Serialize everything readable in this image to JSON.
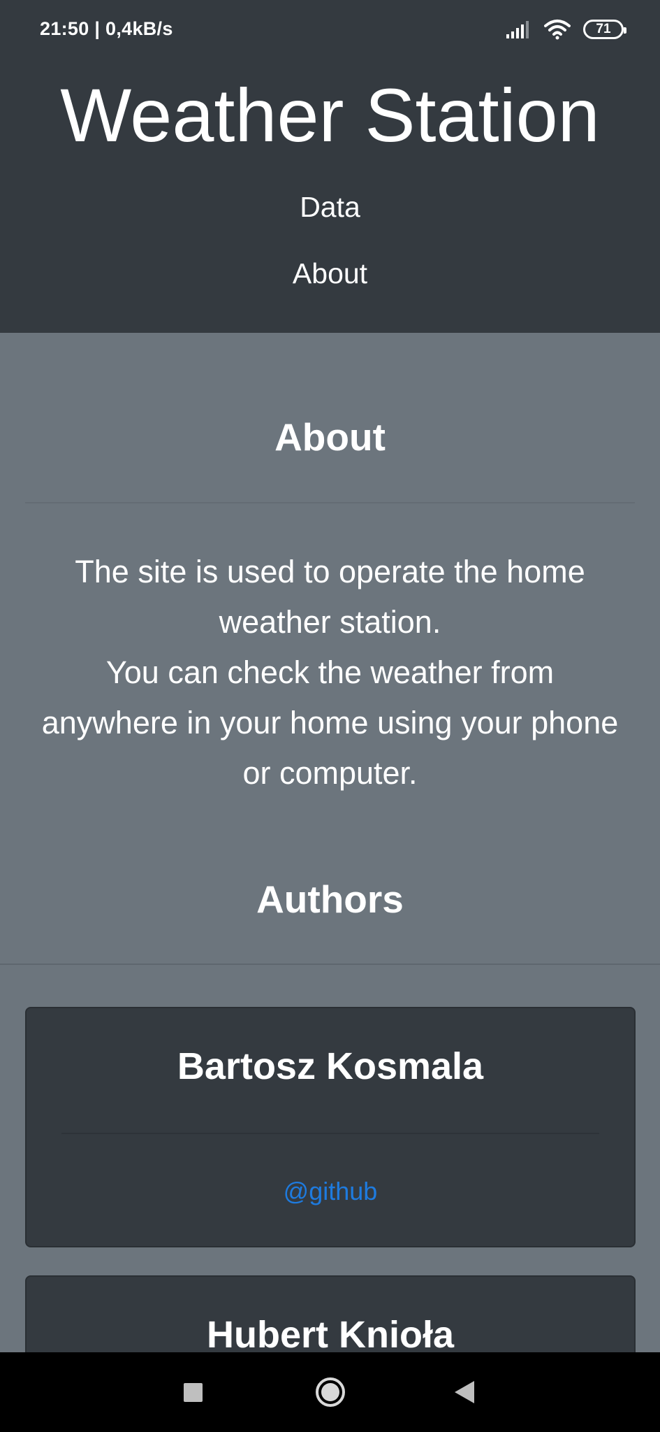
{
  "status_bar": {
    "time_speed": "21:50 | 0,4kB/s",
    "battery_level": "71",
    "icons": [
      "signal-icon",
      "wifi-icon",
      "battery-icon"
    ]
  },
  "header": {
    "title": "Weather Station",
    "nav": [
      "Data",
      "About"
    ]
  },
  "about": {
    "heading": "About",
    "text_lines": [
      "The site is used to operate the home",
      "weather station.",
      "You can check the weather from",
      "anywhere in your home using your phone",
      "or computer."
    ]
  },
  "authors": {
    "heading": "Authors",
    "cards": [
      {
        "name": "Bartosz Kosmala",
        "link": "@github"
      },
      {
        "name": "Hubert Knioła"
      }
    ]
  },
  "android_nav": {
    "buttons": [
      "recents-icon",
      "home-icon",
      "back-icon"
    ]
  },
  "colors": {
    "header_bg": "#343a40",
    "page_bg": "#6c757d",
    "link": "#1e7bdf"
  }
}
